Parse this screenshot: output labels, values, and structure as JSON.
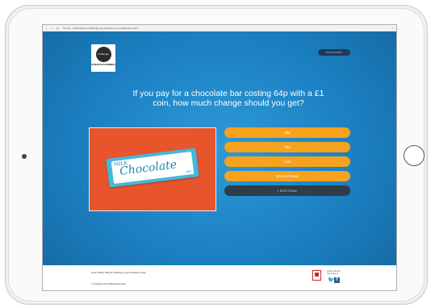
{
  "browser": {
    "secure_label": "Secure",
    "url": "https://www.mrchallenge.org.uk/access-my-maths/index.html"
  },
  "header": {
    "logo_text": "Challenge",
    "logo_tagline": "STRENGTH IN NUMBERS",
    "top_button": "MY ACCOUNT"
  },
  "quiz": {
    "question": "If you pay for a chocolate bar costing 64p with a £1 coin, how much change should you get?",
    "image": {
      "milk": "MILK",
      "word": "Chocolate",
      "small": "200g"
    },
    "answers": [
      "46p",
      "36p",
      "1.64",
      "None of these"
    ],
    "dont_know": "I don't know",
    "colors": {
      "answer": "#f6a21d",
      "dont_know": "#2f3d49",
      "background": "#1b7fc1"
    }
  },
  "footer": {
    "links": "Home  |  Math  |  Take the Challenge  |  Learn Stepstone  |  Help",
    "copyright": "© Copyright 2017 National Numeracy",
    "follow": "Follow National Numeracy on:"
  },
  "icons": [
    "back-icon",
    "forward-icon",
    "reload-icon",
    "twitter-icon",
    "facebook-icon"
  ]
}
